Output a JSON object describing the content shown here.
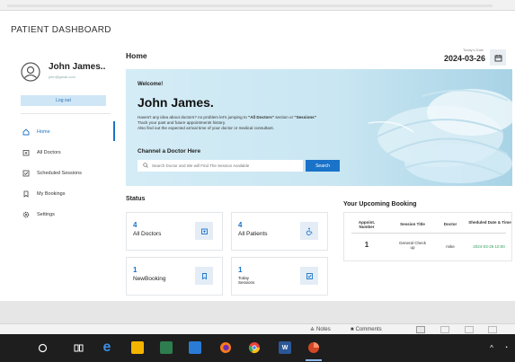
{
  "slide": {
    "title": "PATIENT DASHBOARD"
  },
  "sidebar": {
    "user_name": "John James..",
    "user_email": "john@gmail.com",
    "logout_label": "Log out",
    "items": [
      {
        "label": "Home",
        "icon": "home-icon",
        "active": true
      },
      {
        "label": "All Doctors",
        "icon": "doctor-icon"
      },
      {
        "label": "Scheduled Sessions",
        "icon": "schedule-icon"
      },
      {
        "label": "My Bookings",
        "icon": "bookmark-icon"
      },
      {
        "label": "Settings",
        "icon": "gear-icon"
      }
    ]
  },
  "header": {
    "title": "Home",
    "date_label": "Today's Date",
    "date_value": "2024-03-26"
  },
  "hero": {
    "welcome": "Welcome!",
    "name": "John James.",
    "desc_1": "Haven't any idea about doctors? no problem let's jumping to ",
    "desc_link_1": "\"All Doctors\"",
    "desc_2": " section or ",
    "desc_link_2": "\"Sessions\"",
    "desc_3": "Track your past and future appointments history.",
    "desc_4": "Also find out the expected arrival time of your doctor or medical consultant.",
    "channel_title": "Channel a Doctor Here",
    "search_placeholder": "Search Doctor and We will Find The Session Available",
    "search_button": "Search"
  },
  "status": {
    "title": "Status",
    "cards": [
      {
        "value": "4",
        "label": "All Doctors",
        "icon": "doctor-icon"
      },
      {
        "value": "4",
        "label": "All Patients",
        "icon": "wheelchair-icon"
      },
      {
        "value": "1",
        "label": "NewBooking",
        "icon": "bookmark-icon"
      },
      {
        "value": "1",
        "label": "Today Sessions",
        "icon": "session-icon"
      }
    ]
  },
  "booking": {
    "title": "Your Upcoming Booking",
    "headers": [
      "Appoint. Number",
      "Session Title",
      "Doctor",
      "Sheduled Date & Time"
    ],
    "rows": [
      {
        "number": "1",
        "session": "General Check up",
        "doctor": "mike",
        "datetime": "2024-03-26 10:00"
      }
    ]
  },
  "ppt_status": {
    "notes": "Notes",
    "comments": "Comments"
  }
}
